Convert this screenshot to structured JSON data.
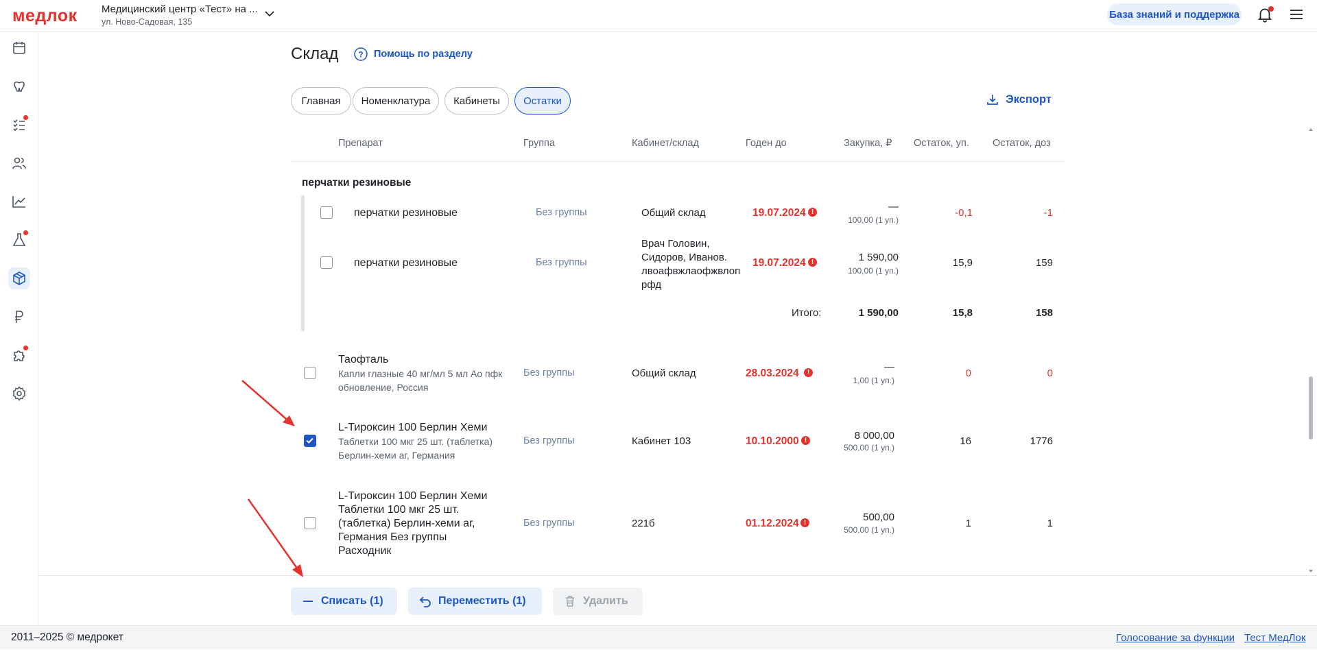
{
  "header": {
    "logo": "медлок",
    "org_name": "Медицинский центр «Тест» на ...",
    "org_address": "ул. Ново-Садовая, 135",
    "kb_button": "База знаний и поддержка"
  },
  "page": {
    "title": "Склад",
    "help_link": "Помощь по разделу",
    "export_label": "Экспорт",
    "tabs": [
      {
        "label": "Главная",
        "active": false
      },
      {
        "label": "Номенклатура",
        "active": false
      },
      {
        "label": "Кабинеты",
        "active": false
      },
      {
        "label": "Остатки",
        "active": true
      }
    ]
  },
  "table": {
    "columns": [
      "Препарат",
      "Группа",
      "Кабинет/склад",
      "Годен до",
      "Закупка, ₽",
      "Остаток, уп.",
      "Остаток, доз"
    ],
    "group": {
      "title": "перчатки резиновые",
      "rows": [
        {
          "name": "перчатки резиновые",
          "group": "Без группы",
          "location": "Общий склад",
          "expiry": "19.07.2024",
          "purchase": "—",
          "purchase_unit": "100,00 (1 уп.)",
          "stock_units": "-0,1",
          "stock_doses": "-1"
        },
        {
          "name": "перчатки резиновые",
          "group": "Без группы",
          "location_lines": [
            "Врач Головин,",
            "Сидоров, Иванов.",
            "лвоафвжлаофжвлоп",
            "рфд"
          ],
          "expiry": "19.07.2024",
          "purchase": "1 590,00",
          "purchase_unit": "100,00 (1 уп.)",
          "stock_units": "15,9",
          "stock_doses": "159"
        }
      ],
      "total_label": "Итого:",
      "total_purchase": "1 590,00",
      "total_units": "15,8",
      "total_doses": "158"
    },
    "rows": [
      {
        "name": "Таофталь",
        "sub_lines": [
          "Капли глазные 40 мг/мл 5 мл Ао пфк",
          "обновление, Россия"
        ],
        "group": "Без группы",
        "location": "Общий склад",
        "expiry": "28.03.2024",
        "purchase": "—",
        "purchase_unit": "1,00 (1 уп.)",
        "stock_units": "0",
        "stock_doses": "0",
        "checked": false
      },
      {
        "name": "L-Тироксин 100 Берлин Хеми",
        "sub_lines": [
          "Таблетки 100 мкг 25 шт. (таблетка)",
          "Берлин-хеми аг, Германия"
        ],
        "group": "Без группы",
        "location": "Кабинет 103",
        "expiry": "10.10.2000",
        "purchase": "8 000,00",
        "purchase_unit": "500,00 (1 уп.)",
        "stock_units": "16",
        "stock_doses": "1776",
        "checked": true
      },
      {
        "name_lines": [
          "L-Тироксин 100 Берлин Хеми",
          "Таблетки 100 мкг 25 шт.",
          "(таблетка) Берлин-хеми аг,",
          "Германия Без группы",
          "Расходник"
        ],
        "group": "Без группы",
        "location": "221б",
        "expiry": "01.12.2024",
        "purchase": "500,00",
        "purchase_unit": "500,00 (1 уп.)",
        "stock_units": "1",
        "stock_doses": "1",
        "checked": false
      }
    ]
  },
  "actions": {
    "write_off": "Списать (1)",
    "move": "Переместить (1)",
    "delete": "Удалить"
  },
  "footer": {
    "copyright": "2011–2025 © медрокет",
    "vote_link": "Голосование за функции",
    "test_link": "Тест МедЛок"
  },
  "colors": {
    "accent": "#1c55c4",
    "danger": "#e5322d",
    "muted": "#5b6470"
  }
}
